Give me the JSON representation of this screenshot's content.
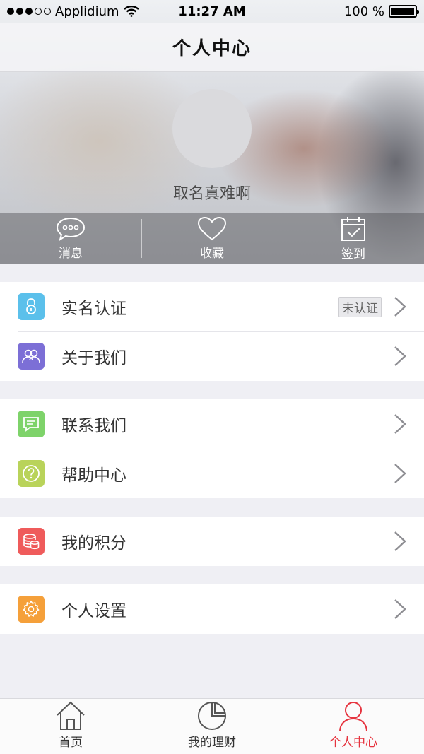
{
  "status_bar": {
    "carrier": "Applidium",
    "time": "11:27 AM",
    "battery": "100 %"
  },
  "nav": {
    "title": "个人中心"
  },
  "profile": {
    "username": "取名真难啊"
  },
  "actions": [
    {
      "label": "消息",
      "icon": "message-icon"
    },
    {
      "label": "收藏",
      "icon": "heart-icon"
    },
    {
      "label": "签到",
      "icon": "calendar-check-icon"
    }
  ],
  "menu": {
    "real_name": {
      "label": "实名认证",
      "badge": "未认证",
      "color": "#5bc0eb"
    },
    "about": {
      "label": "关于我们",
      "color": "#7c6fd6"
    },
    "contact": {
      "label": "联系我们",
      "color": "#7ed36a"
    },
    "help": {
      "label": "帮助中心",
      "color": "#b9d35a"
    },
    "points": {
      "label": "我的积分",
      "color": "#ef5b5b"
    },
    "settings": {
      "label": "个人设置",
      "color": "#f5a03a"
    }
  },
  "tabs": [
    {
      "label": "首页",
      "icon": "home-icon"
    },
    {
      "label": "我的理财",
      "icon": "pie-chart-icon"
    },
    {
      "label": "个人中心",
      "icon": "user-icon",
      "active": true
    }
  ],
  "colors": {
    "accent": "#e6343f",
    "background": "#efeff4"
  }
}
